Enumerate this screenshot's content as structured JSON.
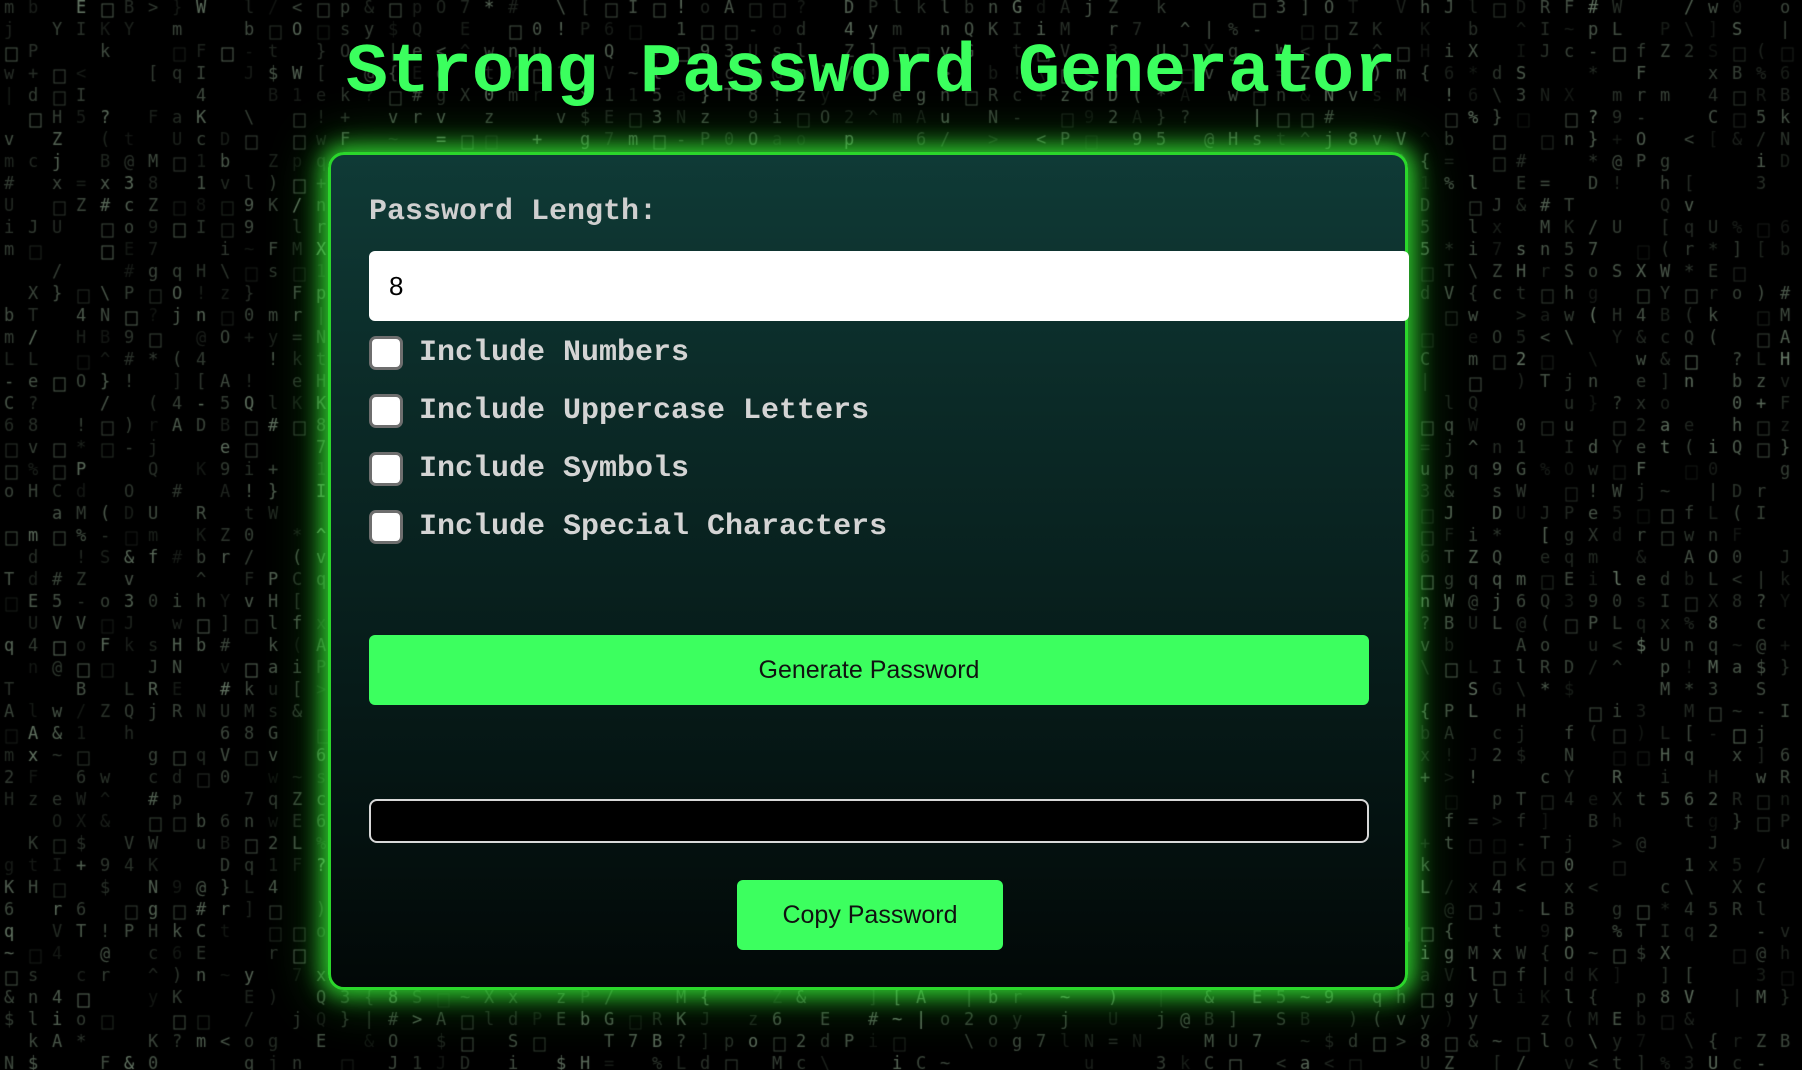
{
  "page": {
    "title": "Strong Password Generator"
  },
  "form": {
    "length_label": "Password Length:",
    "length_value": "8",
    "options": [
      {
        "label": "Include Numbers",
        "checked": false
      },
      {
        "label": "Include Uppercase Letters",
        "checked": false
      },
      {
        "label": "Include Symbols",
        "checked": false
      },
      {
        "label": "Include Special Characters",
        "checked": false
      }
    ],
    "generate_label": "Generate Password",
    "output_value": "",
    "copy_label": "Copy Password"
  },
  "colors": {
    "accent": "#3cff5f",
    "card_top": "#0f3a36",
    "card_bottom": "#020807",
    "background": "#000000"
  }
}
